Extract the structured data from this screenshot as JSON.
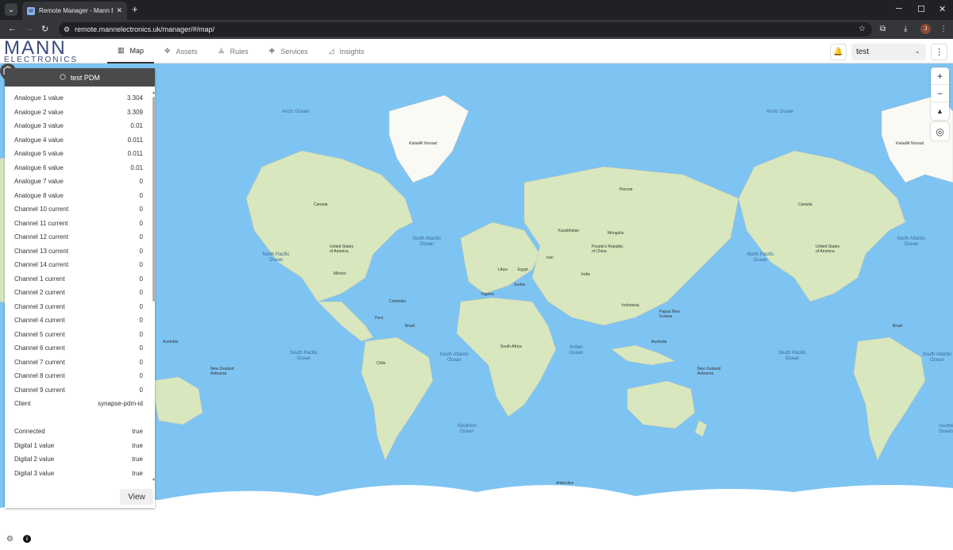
{
  "browser": {
    "tab_title": "Remote Manager - Mann Electronics",
    "url": "remote.mannelectronics.uk/manager/#/map/",
    "profile_initial": "J"
  },
  "header": {
    "logo_line1": "MANN",
    "logo_line2": "ELECTRONICS",
    "tabs": [
      {
        "label": "Map",
        "icon": "map-icon"
      },
      {
        "label": "Assets",
        "icon": "assets-icon"
      },
      {
        "label": "Rules",
        "icon": "rules-icon"
      },
      {
        "label": "Services",
        "icon": "puzzle-icon"
      },
      {
        "label": "Insights",
        "icon": "chart-icon"
      }
    ],
    "realm": "test"
  },
  "panel": {
    "title": "test PDM",
    "attributes": [
      {
        "name": "Analogue 1 value",
        "value": "3.304"
      },
      {
        "name": "Analogue 2 value",
        "value": "3.309"
      },
      {
        "name": "Analogue 3 value",
        "value": "0.01"
      },
      {
        "name": "Analogue 4 value",
        "value": "0.011"
      },
      {
        "name": "Analogue 5 value",
        "value": "0.011"
      },
      {
        "name": "Analogue 6 value",
        "value": "0.01"
      },
      {
        "name": "Analogue 7 value",
        "value": "0"
      },
      {
        "name": "Analogue 8 value",
        "value": "0"
      },
      {
        "name": "Channel 10 current",
        "value": "0"
      },
      {
        "name": "Channel 11 current",
        "value": "0"
      },
      {
        "name": "Channel 12 current",
        "value": "0"
      },
      {
        "name": "Channel 13 current",
        "value": "0"
      },
      {
        "name": "Channel 14 current",
        "value": "0"
      },
      {
        "name": "Channel 1 current",
        "value": "0"
      },
      {
        "name": "Channel 2 current",
        "value": "0"
      },
      {
        "name": "Channel 3 current",
        "value": "0"
      },
      {
        "name": "Channel 4 current",
        "value": "0"
      },
      {
        "name": "Channel 5 current",
        "value": "0"
      },
      {
        "name": "Channel 6 current",
        "value": "0"
      },
      {
        "name": "Channel 7 current",
        "value": "0"
      },
      {
        "name": "Channel 8 current",
        "value": "0"
      },
      {
        "name": "Channel 9 current",
        "value": "0"
      },
      {
        "name": "Client",
        "value": "synapse-pdm-id"
      },
      {
        "name": "Connected",
        "value": "true"
      },
      {
        "name": "Digital 1 value",
        "value": "true"
      },
      {
        "name": "Digital 2 value",
        "value": "true"
      },
      {
        "name": "Digital 3 value",
        "value": "true"
      }
    ],
    "view_label": "View"
  },
  "map": {
    "labels": {
      "arctic": "Arctic Ocean",
      "north_atlantic": "North Atlantic Ocean",
      "north_pacific": "North Pacific Ocean",
      "south_pacific": "South Pacific Ocean",
      "south_atlantic": "South Atlantic Ocean",
      "indian": "Indian Ocean",
      "southern": "Southern Ocean",
      "antarctica": "Antarctica",
      "greenland": "Kalaallit Nunaat",
      "canada": "Canada",
      "usa": "United States of America",
      "brasil": "Brasil",
      "russia": "Россия",
      "china": "People's Republic of China",
      "australia": "Australia",
      "india": "India",
      "kazakhstan": "Kazakhstan",
      "mongolia": "Mongolia",
      "indonesia": "Indonesia",
      "mexico": "México",
      "png": "Papua New Guinea",
      "nz": "New Zealand Aotearoa",
      "libya": "Libya",
      "egypt": "Egypt",
      "nigeria": "Nigeria",
      "south_africa": "South Africa",
      "iran": "Iran",
      "sudan": "Sudan",
      "peru": "Perú",
      "colombia": "Colombia",
      "chile": "Chile"
    }
  }
}
